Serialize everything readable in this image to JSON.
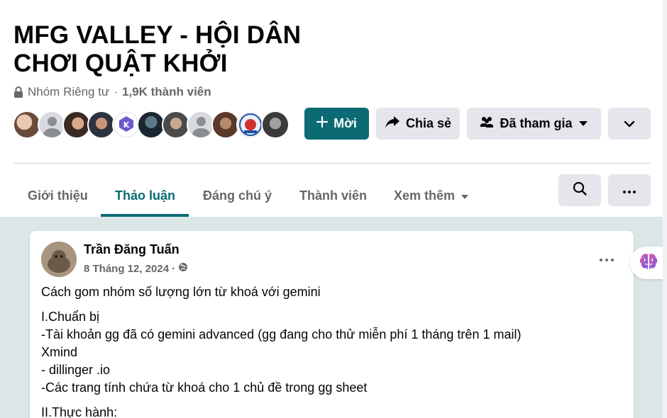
{
  "group": {
    "title_line1": "MFG VALLEY - HỘI DÂN",
    "title_line2": "CHƠI QUẬT KHỞI",
    "privacy": "Nhóm Riêng tư",
    "separator": "·",
    "member_count": "1,9K thành viên"
  },
  "actions": {
    "invite_label": "Mời",
    "share_label": "Chia sẻ",
    "joined_label": "Đã tham gia"
  },
  "tabs": [
    {
      "label": "Giới thiệu"
    },
    {
      "label": "Thảo luận",
      "active": true
    },
    {
      "label": "Đáng chú ý"
    },
    {
      "label": "Thành viên"
    },
    {
      "label": "Xem thêm"
    }
  ],
  "post": {
    "author": "Trần Đăng Tuấn",
    "date": "8 Tháng 12, 2024",
    "date_separator": "·",
    "audience_icon": "globe-icon",
    "lines": [
      "Cách gom nhóm số lượng lớn từ khoá với gemini",
      "I.Chuẩn bị",
      "-Tài khoản gg đã có gemini advanced (gg đang cho thử miễn phí 1 tháng trên 1 mail)",
      "Xmind",
      "- dillinger .io",
      "-Các trang tính chứa từ khoá cho 1 chủ đề trong gg sheet",
      "II.Thực hành:"
    ]
  },
  "colors": {
    "accent": "#0b6a74",
    "button_gray": "#e4e6eb",
    "feed_bg": "#dbe7e7",
    "secondary_text": "#65676b"
  }
}
